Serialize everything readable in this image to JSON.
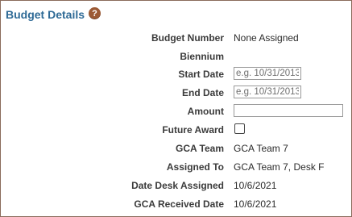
{
  "section": {
    "title": "Budget Details",
    "help_icon": "question-circle-icon"
  },
  "fields": {
    "budget_number": {
      "label": "Budget Number",
      "value": "None Assigned"
    },
    "biennium": {
      "label": "Biennium",
      "value": ""
    },
    "start_date": {
      "label": "Start Date",
      "placeholder": "e.g. 10/31/2013",
      "value": ""
    },
    "end_date": {
      "label": "End Date",
      "placeholder": "e.g. 10/31/2013",
      "value": ""
    },
    "amount": {
      "label": "Amount",
      "value": ""
    },
    "future_award": {
      "label": "Future Award",
      "checked": false
    },
    "gca_team": {
      "label": "GCA Team",
      "value": "GCA Team 7"
    },
    "assigned_to": {
      "label": "Assigned To",
      "value": "GCA Team 7, Desk F"
    },
    "date_desk_assigned": {
      "label": "Date Desk Assigned",
      "value": "10/6/2021"
    },
    "gca_received_date": {
      "label": "GCA Received Date",
      "value": "10/6/2021"
    }
  },
  "colors": {
    "title": "#2e6a96",
    "panel_border": "#8a6b5b",
    "help_icon_bg": "#9c5a35"
  }
}
